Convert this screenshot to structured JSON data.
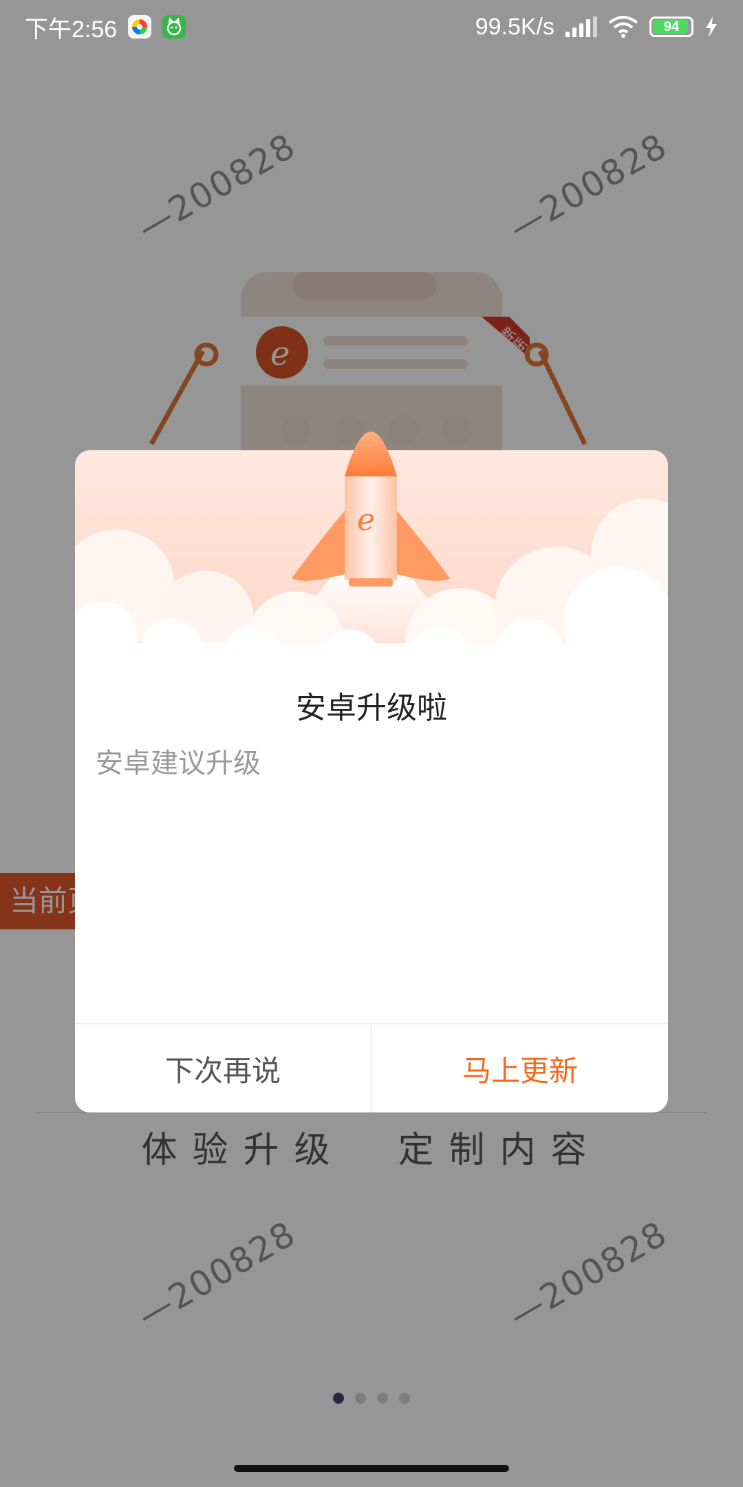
{
  "status_bar": {
    "time": "下午2:56",
    "network_speed": "99.5K/s",
    "battery_level": "94",
    "icons": [
      "photos-app-icon",
      "cat-app-icon",
      "signal-icon",
      "wifi-icon",
      "battery-icon",
      "charging-icon"
    ]
  },
  "background": {
    "watermark_text": "—200828",
    "badge_new": "新版",
    "current_tab_label": "当前页",
    "slogan": "体验升级  定制内容",
    "pager": {
      "total": 4,
      "active": 1
    }
  },
  "dialog": {
    "title": "安卓升级啦",
    "message": "安卓建议升级",
    "later_button": "下次再说",
    "update_button": "马上更新"
  },
  "colors": {
    "accent": "#f26a1b",
    "current_pill": "#e2572c",
    "overlay": "rgba(0,0,0,0.41)"
  }
}
